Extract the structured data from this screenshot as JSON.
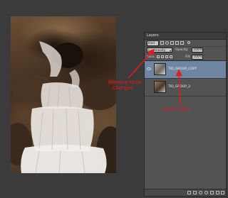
{
  "panel": {
    "tab_label": "Layers",
    "filter_kind": "Kind",
    "blend_mode": "Luminosity",
    "opacity_label": "Opacity:",
    "opacity_value": "100%",
    "lock_label": "Lock:",
    "fill_label": "Fill:",
    "fill_value": "100%",
    "layers": [
      {
        "name": "TID_GROUP_COPY",
        "active": true,
        "visible": true
      },
      {
        "name": "TID_GROUP_2",
        "active": false,
        "visible": false
      }
    ]
  },
  "annotations": {
    "blend_line1": "Blending Mode",
    "blend_line2": "Changed",
    "active_layer": "Active Layer",
    "color": "#e11d1d"
  },
  "colors": {
    "panel_bg": "#535353",
    "active_layer_bg": "#6f86a3",
    "app_bg": "#3b3b3b"
  }
}
